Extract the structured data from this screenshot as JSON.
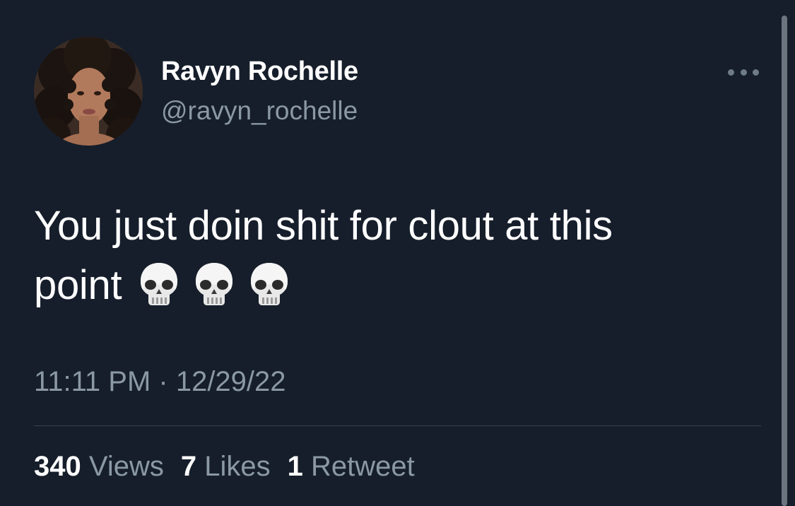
{
  "tweet": {
    "author": {
      "display_name": "Ravyn Rochelle",
      "handle": "@ravyn_rochelle"
    },
    "text": {
      "line1": "You just doin shit for clout at this",
      "line2": "point",
      "emojis": [
        "skull-icon",
        "skull-icon",
        "skull-icon"
      ]
    },
    "timestamp": "11:11 PM · 12/29/22",
    "stats": {
      "views_count": "340",
      "views_label": "Views",
      "likes_count": "7",
      "likes_label": "Likes",
      "retweets_count": "1",
      "retweets_label": "Retweet"
    }
  },
  "theme": {
    "background": "#161e2b",
    "primary_text": "#ffffff",
    "secondary_text": "#8b98a5",
    "divider": "#38444d"
  }
}
